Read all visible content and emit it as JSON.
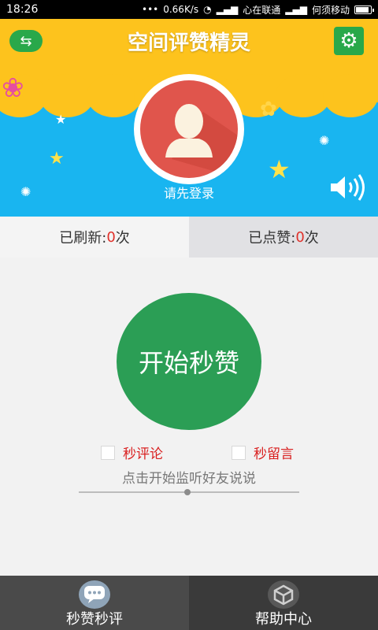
{
  "status_bar": {
    "time": "18:26",
    "network_speed": "0.66K/s",
    "carrier1": "心在联通",
    "carrier2": "何须移动"
  },
  "header": {
    "title": "空间评赞精灵",
    "swap_icon": "swap-arrows-icon",
    "settings_icon": "gear-icon",
    "login_prompt": "请先登录",
    "sound_icon": "speaker-icon"
  },
  "tabs": {
    "refreshed_label": "已刷新:",
    "refreshed_count": "0",
    "refreshed_unit": "次",
    "liked_label": "已点赞:",
    "liked_count": "0",
    "liked_unit": "次"
  },
  "main": {
    "start_button": "开始秒赞",
    "option_comment": "秒评论",
    "option_message": "秒留言",
    "hint": "点击开始监听好友说说"
  },
  "bottom_nav": {
    "items": [
      {
        "label": "秒赞秒评",
        "icon": "chat-bubble-icon"
      },
      {
        "label": "帮助中心",
        "icon": "help-box-icon"
      }
    ]
  },
  "colors": {
    "header_yellow": "#fdc31d",
    "header_blue": "#19b5f0",
    "accent_green": "#2b9e55",
    "count_red": "#e0312a",
    "option_red": "#d92020"
  }
}
